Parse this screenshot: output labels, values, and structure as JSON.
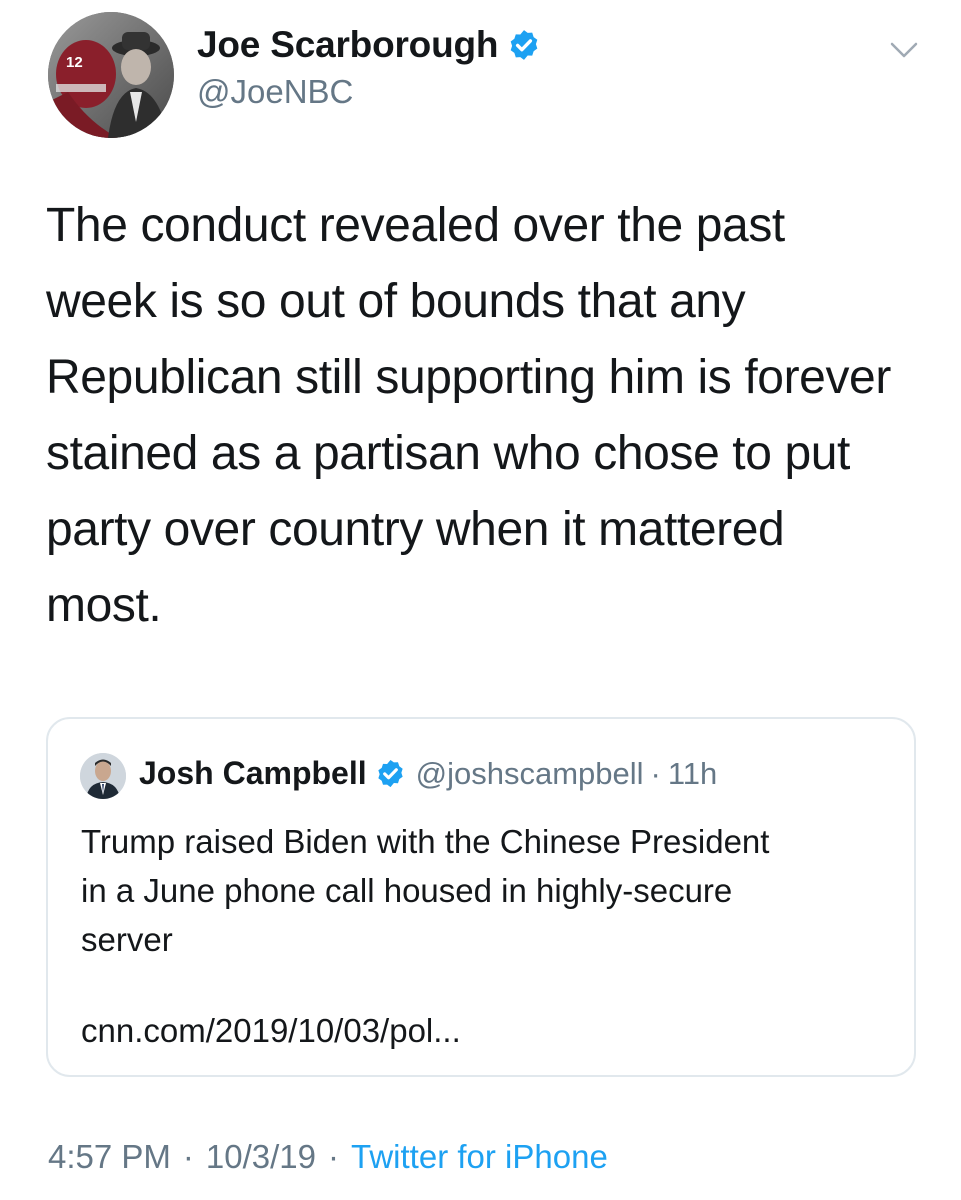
{
  "author": {
    "name": "Joe Scarborough",
    "handle": "@JoeNBC",
    "avatar_jersey_number": "12",
    "verified": true
  },
  "tweet": {
    "text": "The conduct revealed over the past\nweek is so out of bounds that any\nRepublican still supporting him is forever\nstained as a partisan who chose to put\nparty over country when it mattered\nmost."
  },
  "quoted_tweet": {
    "name": "Josh Campbell",
    "handle": "@joshscampbell",
    "separator": "·",
    "time": "11h",
    "verified": true,
    "text": "Trump raised Biden with the Chinese President\nin a June phone call housed in highly-secure\nserver",
    "link": "cnn.com/2019/10/03/pol..."
  },
  "meta": {
    "time": "4:57 PM",
    "date": "10/3/19",
    "separator": "·",
    "source": "Twitter for iPhone"
  },
  "colors": {
    "text": "#14171a",
    "secondary": "#657786",
    "accent": "#1da1f2",
    "border": "#e1e8ed"
  },
  "icons": {
    "verified": "verified-badge-icon",
    "menu": "chevron-down-icon"
  }
}
